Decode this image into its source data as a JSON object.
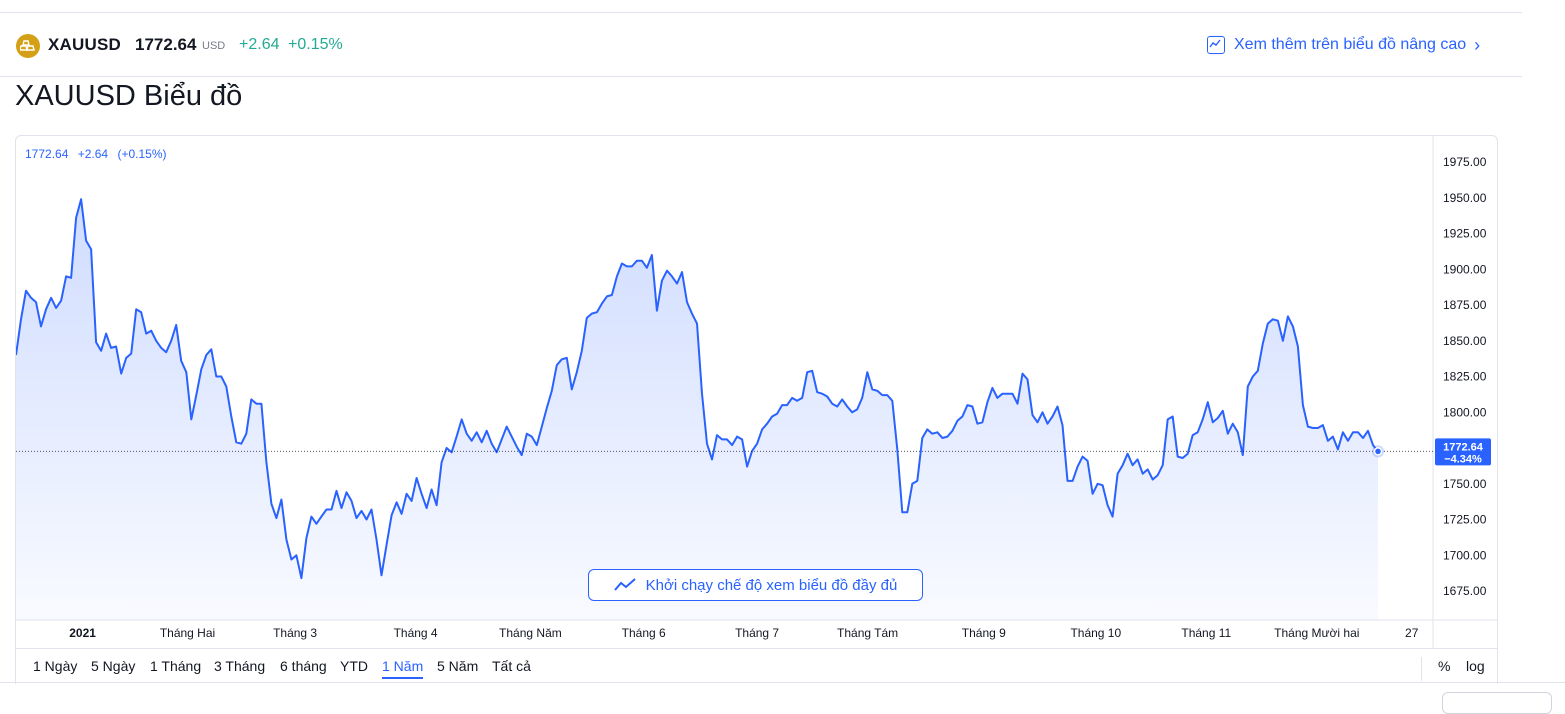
{
  "header": {
    "symbol": "XAUUSD",
    "price": "1772.64",
    "currency": "USD",
    "change": "+2.64",
    "change_pct": "+0.15%",
    "advanced_link": "Xem thêm trên biểu đồ nâng cao"
  },
  "page_title": "XAUUSD Biểu đồ",
  "legend": {
    "price": "1772.64",
    "change": "+2.64",
    "change_pct": "(+0.15%)"
  },
  "full_chart_button": "Khởi chạy chế độ xem biểu đồ đầy đủ",
  "ranges": [
    {
      "label": "1 Ngày",
      "active": false
    },
    {
      "label": "5 Ngày",
      "active": false
    },
    {
      "label": "1 Tháng",
      "active": false
    },
    {
      "label": "3 Tháng",
      "active": false
    },
    {
      "label": "6 tháng",
      "active": false
    },
    {
      "label": "YTD",
      "active": false
    },
    {
      "label": "1 Năm",
      "active": true
    },
    {
      "label": "5 Năm",
      "active": false
    },
    {
      "label": "Tất cả",
      "active": false
    }
  ],
  "scale_options": [
    "%",
    "log"
  ],
  "colors": {
    "line": "#2962ff",
    "positive": "#22ab94",
    "gold": "#d4a017"
  },
  "chart_data": {
    "type": "area",
    "title": "",
    "xlabel": "",
    "ylabel": "",
    "ylim": [
      1660,
      1990
    ],
    "y_ticks": [
      "1975.00",
      "1950.00",
      "1925.00",
      "1900.00",
      "1875.00",
      "1850.00",
      "1825.00",
      "1800.00",
      "1750.00",
      "1725.00",
      "1700.00",
      "1675.00"
    ],
    "x_ticks": [
      {
        "label": "2021",
        "pos": 0.047
      },
      {
        "label": "Tháng Hai",
        "pos": 0.121
      },
      {
        "label": "Tháng 3",
        "pos": 0.197
      },
      {
        "label": "Tháng 4",
        "pos": 0.282
      },
      {
        "label": "Tháng Năm",
        "pos": 0.363
      },
      {
        "label": "Tháng 6",
        "pos": 0.443
      },
      {
        "label": "Tháng 7",
        "pos": 0.523
      },
      {
        "label": "Tháng Tám",
        "pos": 0.601
      },
      {
        "label": "Tháng 9",
        "pos": 0.683
      },
      {
        "label": "Tháng 10",
        "pos": 0.762
      },
      {
        "label": "Tháng 11",
        "pos": 0.84
      },
      {
        "label": "Tháng Mười hai",
        "pos": 0.918
      },
      {
        "label": "27",
        "pos": 0.985
      }
    ],
    "last_price": "1772.64",
    "last_change_pct": "−4.34%",
    "reference_value": 1772.64,
    "series": [
      {
        "values": [
          1840,
          1865,
          1885,
          1880,
          1877,
          1860,
          1872,
          1880,
          1873,
          1878,
          1895,
          1894,
          1936,
          1949,
          1920,
          1914,
          1849,
          1843,
          1855,
          1845,
          1846,
          1827,
          1838,
          1841,
          1872,
          1870,
          1855,
          1857,
          1850,
          1845,
          1842,
          1850,
          1861,
          1836,
          1828,
          1795,
          1812,
          1830,
          1840,
          1844,
          1825,
          1825,
          1818,
          1797,
          1779,
          1778,
          1785,
          1809,
          1806,
          1806,
          1765,
          1736,
          1726,
          1739,
          1711,
          1697,
          1700,
          1684,
          1712,
          1727,
          1722,
          1727,
          1732,
          1732,
          1745,
          1733,
          1744,
          1738,
          1726,
          1731,
          1725,
          1732,
          1711,
          1686,
          1707,
          1728,
          1737,
          1729,
          1743,
          1738,
          1754,
          1743,
          1733,
          1746,
          1735,
          1765,
          1775,
          1772,
          1783,
          1795,
          1785,
          1780,
          1786,
          1779,
          1787,
          1778,
          1772,
          1781,
          1790,
          1783,
          1776,
          1770,
          1785,
          1783,
          1777,
          1790,
          1803,
          1815,
          1833,
          1837,
          1838,
          1816,
          1828,
          1843,
          1866,
          1869,
          1870,
          1876,
          1881,
          1882,
          1895,
          1904,
          1902,
          1902,
          1906,
          1906,
          1901,
          1910,
          1871,
          1892,
          1899,
          1895,
          1890,
          1898,
          1877,
          1869,
          1862,
          1813,
          1778,
          1767,
          1784,
          1781,
          1781,
          1777,
          1783,
          1781,
          1762,
          1773,
          1778,
          1788,
          1792,
          1797,
          1799,
          1805,
          1805,
          1810,
          1808,
          1810,
          1828,
          1829,
          1814,
          1813,
          1811,
          1806,
          1804,
          1809,
          1804,
          1800,
          1802,
          1810,
          1828,
          1816,
          1815,
          1812,
          1812,
          1808,
          1774,
          1730,
          1730,
          1750,
          1752,
          1782,
          1788,
          1785,
          1786,
          1782,
          1783,
          1787,
          1794,
          1797,
          1805,
          1804,
          1792,
          1793,
          1807,
          1817,
          1810,
          1813,
          1813,
          1813,
          1806,
          1827,
          1823,
          1798,
          1793,
          1800,
          1792,
          1797,
          1804,
          1791,
          1752,
          1752,
          1762,
          1769,
          1766,
          1743,
          1750,
          1749,
          1735,
          1727,
          1757,
          1763,
          1771,
          1763,
          1767,
          1757,
          1760,
          1753,
          1756,
          1763,
          1795,
          1797,
          1769,
          1768,
          1771,
          1784,
          1786,
          1795,
          1807,
          1793,
          1796,
          1801,
          1785,
          1792,
          1786,
          1770,
          1818,
          1825,
          1829,
          1848,
          1862,
          1865,
          1864,
          1850,
          1867,
          1860,
          1846,
          1805,
          1790,
          1789,
          1789,
          1791,
          1780,
          1783,
          1774,
          1786,
          1780,
          1786,
          1786,
          1782,
          1787,
          1777,
          1772.64
        ]
      }
    ]
  }
}
